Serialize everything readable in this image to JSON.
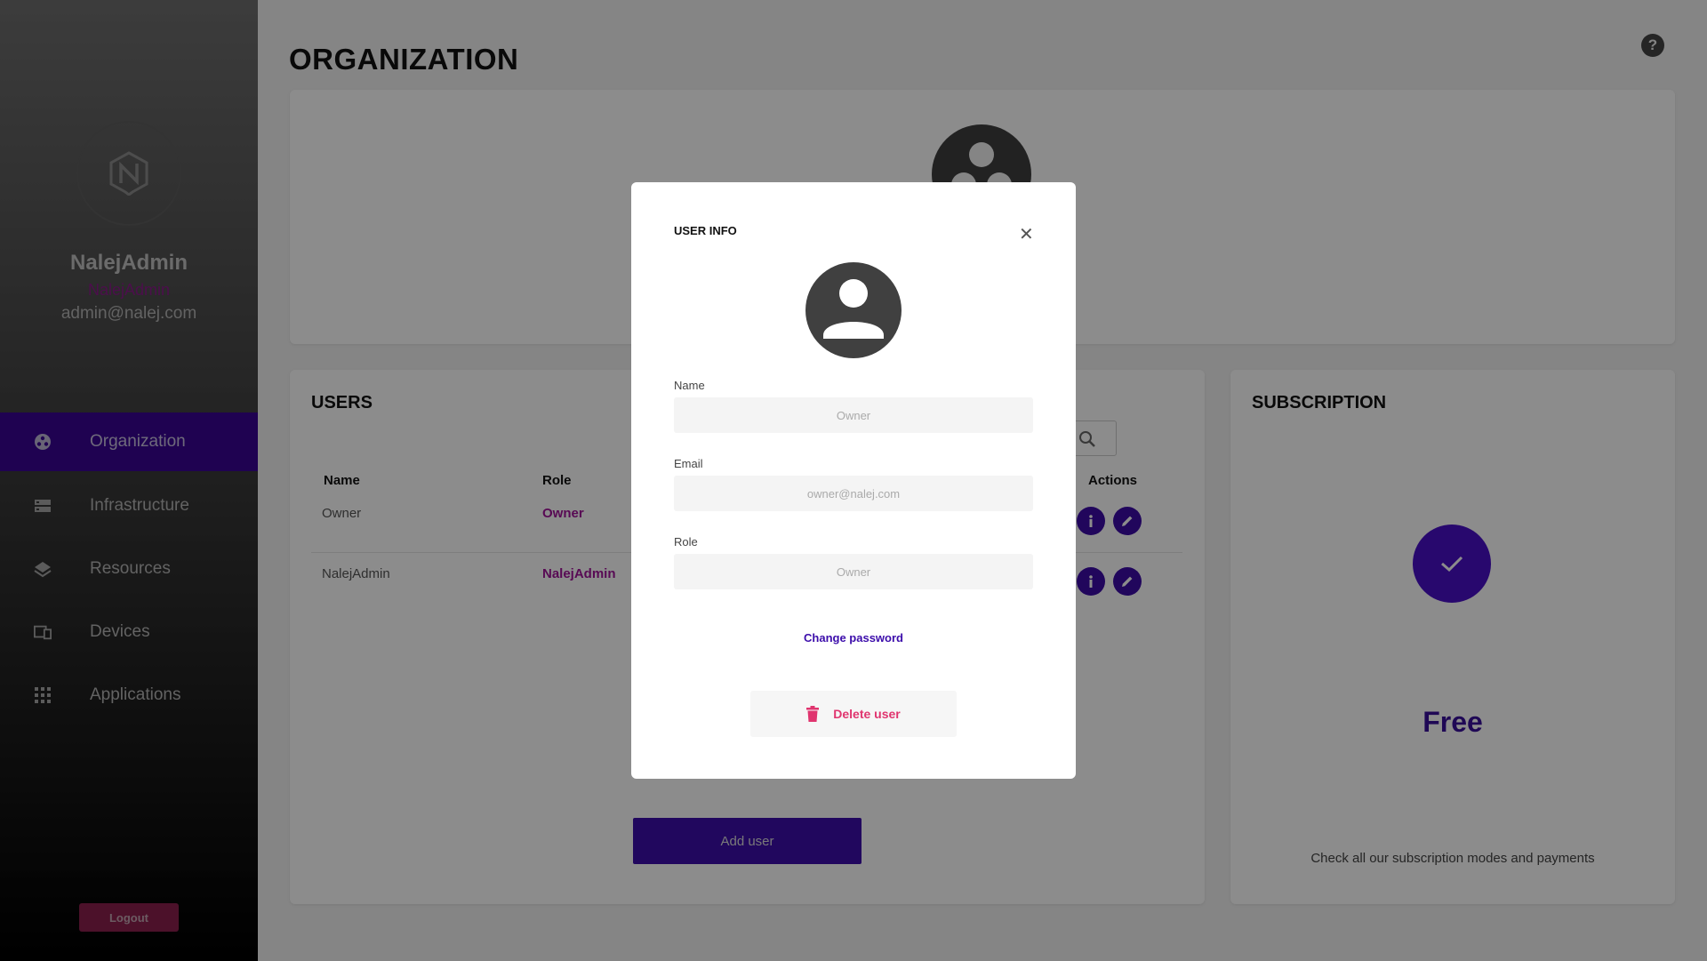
{
  "sidebar": {
    "user_name": "NalejAdmin",
    "user_role": "NalejAdmin",
    "user_email": "admin@nalej.com",
    "items": [
      {
        "label": "Organization",
        "icon": "organization-icon",
        "active": true
      },
      {
        "label": "Infrastructure",
        "icon": "server-icon",
        "active": false
      },
      {
        "label": "Resources",
        "icon": "layers-icon",
        "active": false
      },
      {
        "label": "Devices",
        "icon": "devices-icon",
        "active": false
      },
      {
        "label": "Applications",
        "icon": "apps-grid-icon",
        "active": false
      }
    ],
    "logout_label": "Logout"
  },
  "main": {
    "title": "ORGANIZATION",
    "users": {
      "title": "USERS",
      "columns": {
        "name": "Name",
        "role": "Role",
        "actions": "Actions"
      },
      "rows": [
        {
          "name": "Owner",
          "role": "Owner"
        },
        {
          "name": "NalejAdmin",
          "role": "NalejAdmin"
        }
      ],
      "add_user_label": "Add user"
    },
    "subscription": {
      "title": "SUBSCRIPTION",
      "plan": "Free",
      "note": "Check all our subscription modes and payments"
    }
  },
  "modal": {
    "title": "USER INFO",
    "name_label": "Name",
    "name_value": "Owner",
    "email_label": "Email",
    "email_value": "owner@nalej.com",
    "role_label": "Role",
    "role_value": "Owner",
    "change_password_label": "Change password",
    "delete_label": "Delete user"
  },
  "colors": {
    "accent": "#3c0dab",
    "role_magenta": "#a0139a",
    "danger": "#e0356f"
  }
}
